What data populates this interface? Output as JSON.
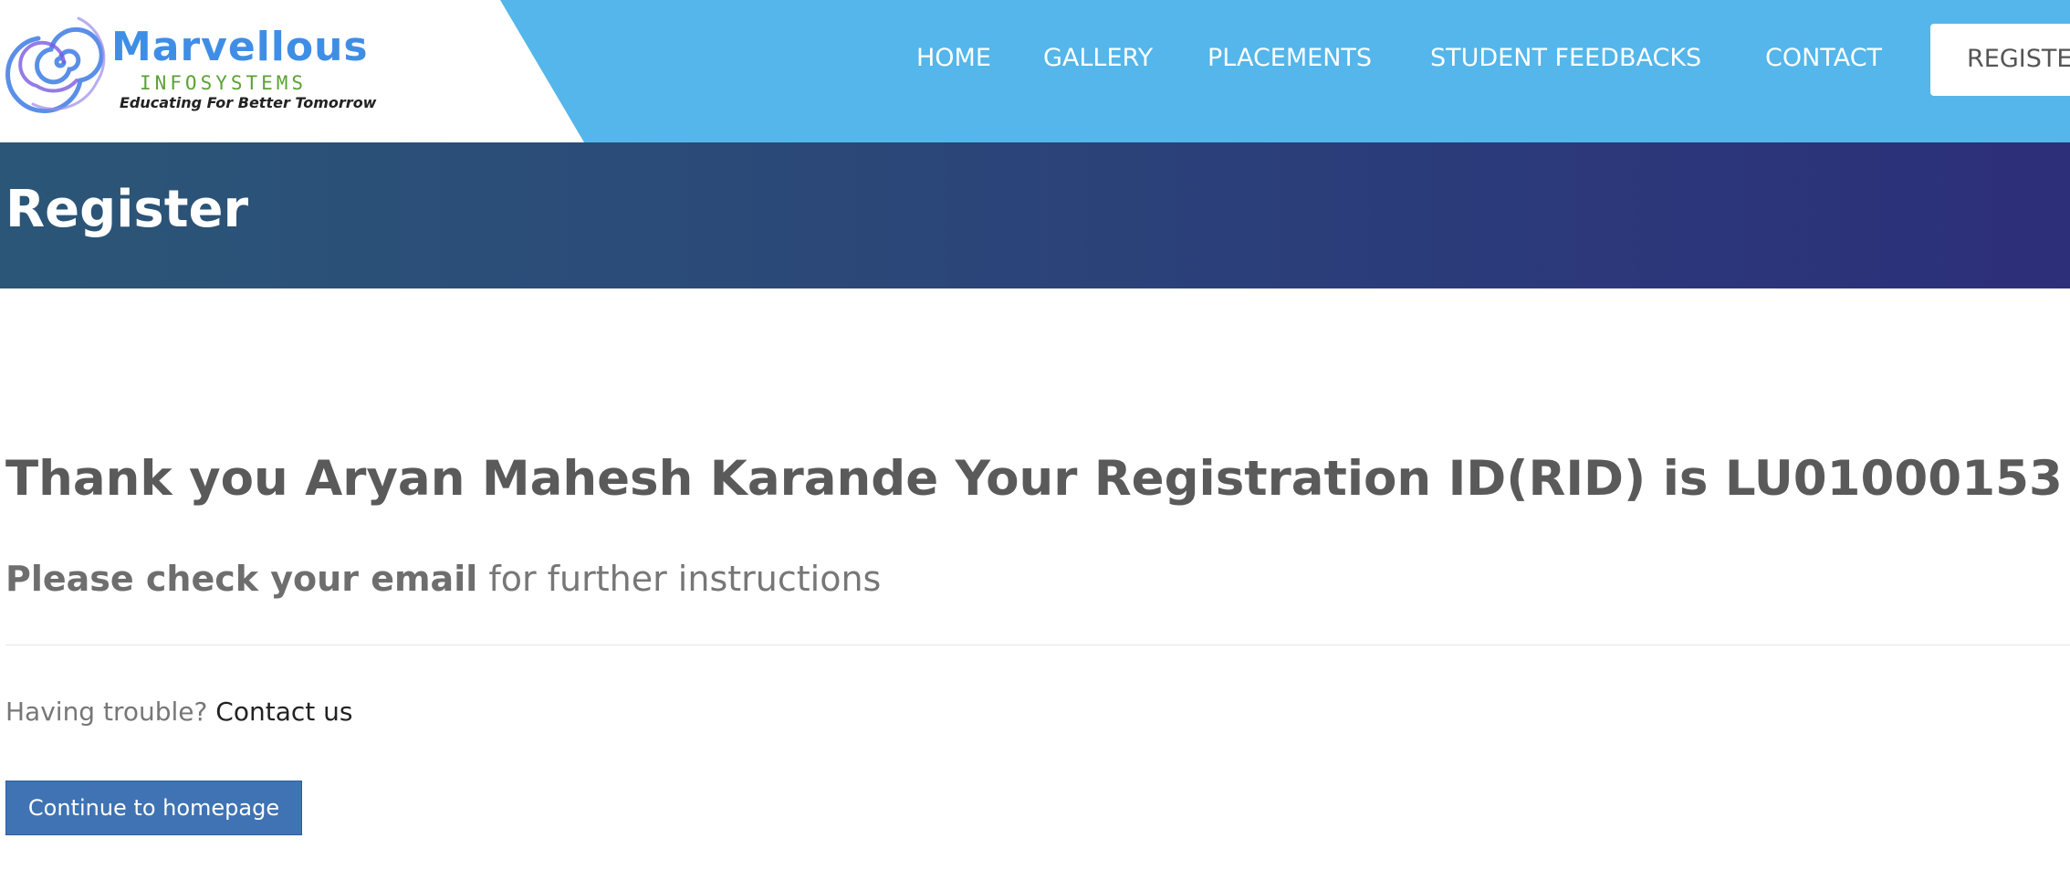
{
  "header": {
    "logo": {
      "name": "Marvellous",
      "subtitle": "INFOSYSTEMS",
      "tagline": "Educating For Better Tomorrow"
    },
    "nav": [
      "HOME",
      "GALLERY",
      "PLACEMENTS",
      "STUDENT FEEDBACKS",
      "CONTACT"
    ],
    "register_label": "REGISTER"
  },
  "banner": {
    "title": "Register"
  },
  "main": {
    "thanks_message": "Thank you Aryan Mahesh Karande Your Registration ID(RID) is LU01000153",
    "email_bold": "Please check your email",
    "email_rest": " for further instructions",
    "trouble_text": "Having trouble? ",
    "contact_link": "Contact us",
    "continue_button": "Continue to homepage"
  },
  "colors": {
    "header_bg": "#54b6ea",
    "banner_gradient_start": "#2b5677",
    "banner_gradient_end": "#2d2f79",
    "button_bg": "#3f73b3"
  }
}
